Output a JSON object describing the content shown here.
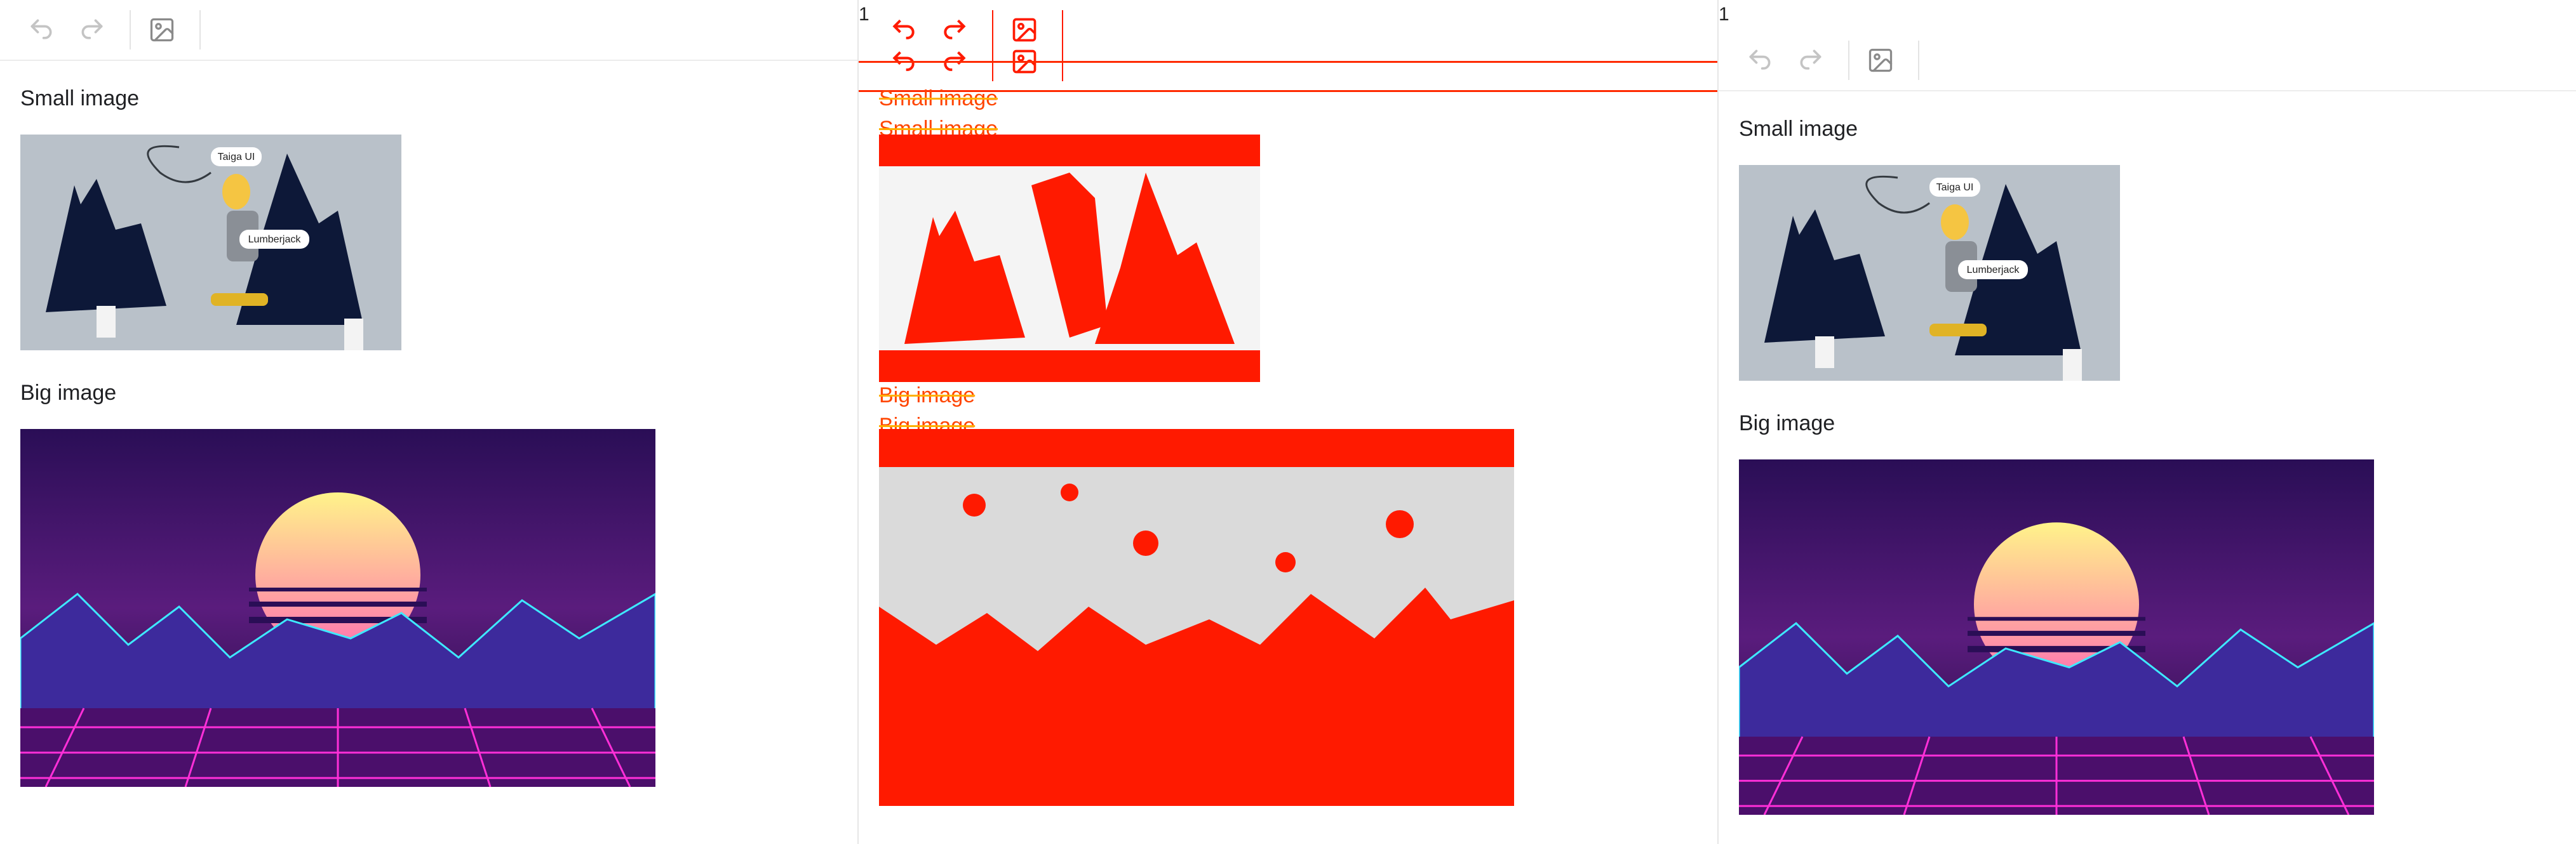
{
  "panels": {
    "expected": {
      "toolbar": {
        "undo_icon": "undo-icon",
        "redo_icon": "redo-icon",
        "image_icon": "image-icon"
      },
      "small_label": "Small image",
      "big_label": "Big image"
    },
    "diff": {
      "marker": "1",
      "small_label": "Small image",
      "big_label": "Big image"
    },
    "actual": {
      "marker": "1",
      "small_label": "Small image",
      "big_label": "Big image"
    }
  },
  "illustration": {
    "bubble_1": "Taiga UI",
    "bubble_2": "Lumberjack"
  },
  "colors": {
    "diff_red": "#ff1a00",
    "diff_text": "#ff4500",
    "toolbar_icon": "#bdbdbd"
  }
}
